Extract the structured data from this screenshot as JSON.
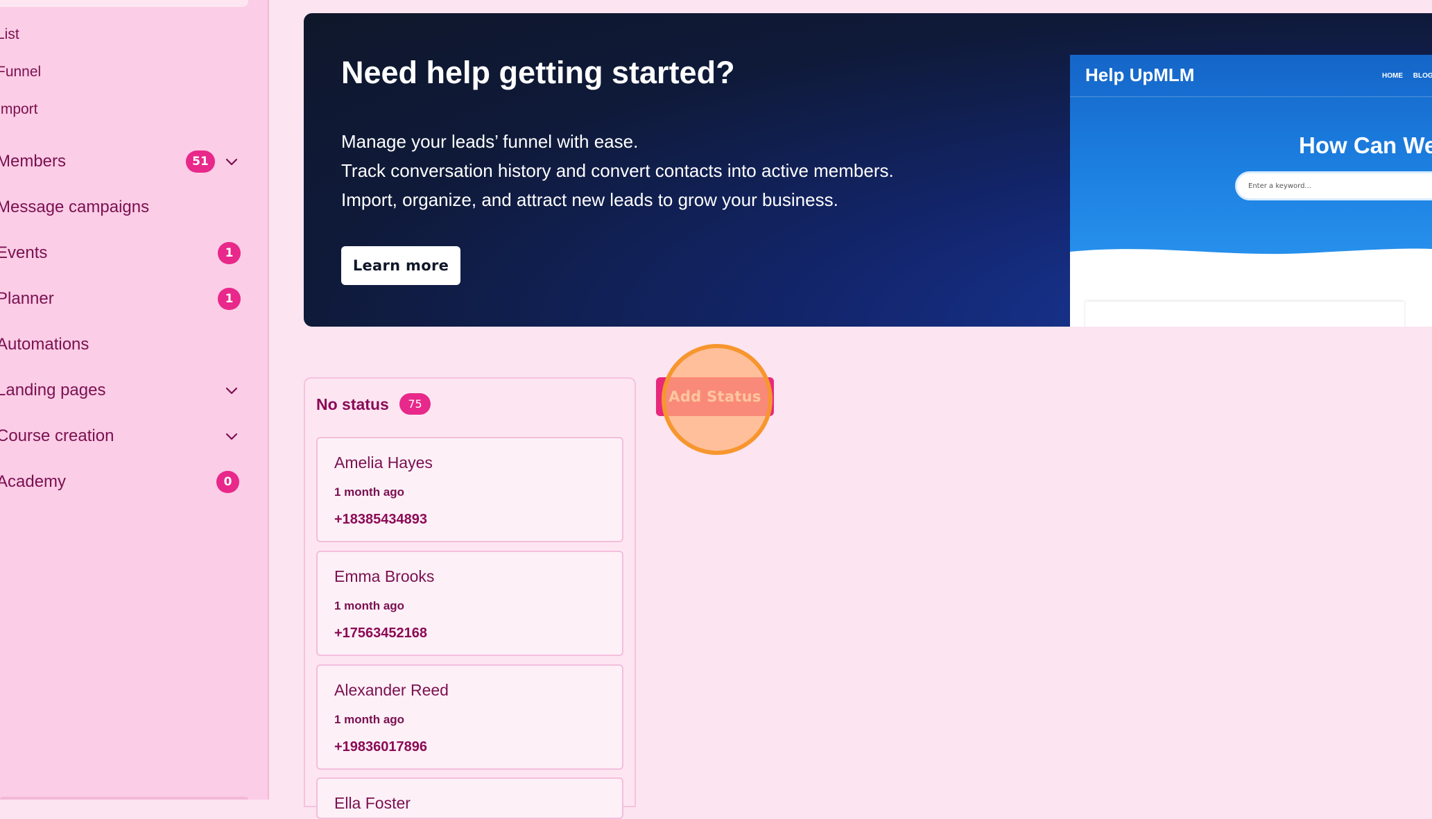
{
  "sidebar": {
    "sub_items": [
      "List",
      "Funnel",
      "Import"
    ],
    "items": [
      {
        "label": "Members",
        "badge": "51",
        "chevron": true
      },
      {
        "label": "Message campaigns",
        "badge": null,
        "chevron": false
      },
      {
        "label": "Events",
        "badge": "1",
        "chevron": false
      },
      {
        "label": "Planner",
        "badge": "1",
        "chevron": false
      },
      {
        "label": "Automations",
        "badge": null,
        "chevron": false
      },
      {
        "label": "Landing pages",
        "badge": null,
        "chevron": true
      },
      {
        "label": "Course creation",
        "badge": null,
        "chevron": true
      },
      {
        "label": "Academy",
        "badge": "0",
        "chevron": false
      }
    ]
  },
  "hero": {
    "title": "Need help getting started?",
    "description": [
      "Manage your leads’ funnel with ease.",
      "Track conversation history and convert contacts into active members.",
      "Import, organize, and attract new leads to grow your business."
    ],
    "button_label": "Learn more",
    "preview": {
      "brand": "Help UpMLM",
      "nav": "HOME BLOG",
      "headline": "How Can We",
      "search_placeholder": "Enter a keyword..."
    }
  },
  "board": {
    "column": {
      "title": "No status",
      "count": "75",
      "cards": [
        {
          "name": "Amelia Hayes",
          "time": "1 month ago",
          "phone": "+18385434893"
        },
        {
          "name": "Emma Brooks",
          "time": "1 month ago",
          "phone": "+17563452168"
        },
        {
          "name": "Alexander Reed",
          "time": "1 month ago",
          "phone": "+19836017896"
        }
      ],
      "partial_card_name": "Ella Foster"
    },
    "add_status_label": "Add Status"
  },
  "colors": {
    "accent": "#e8288a",
    "text": "#7a1050",
    "hero_bg": "#0f172a",
    "highlight": "#f7962e"
  }
}
